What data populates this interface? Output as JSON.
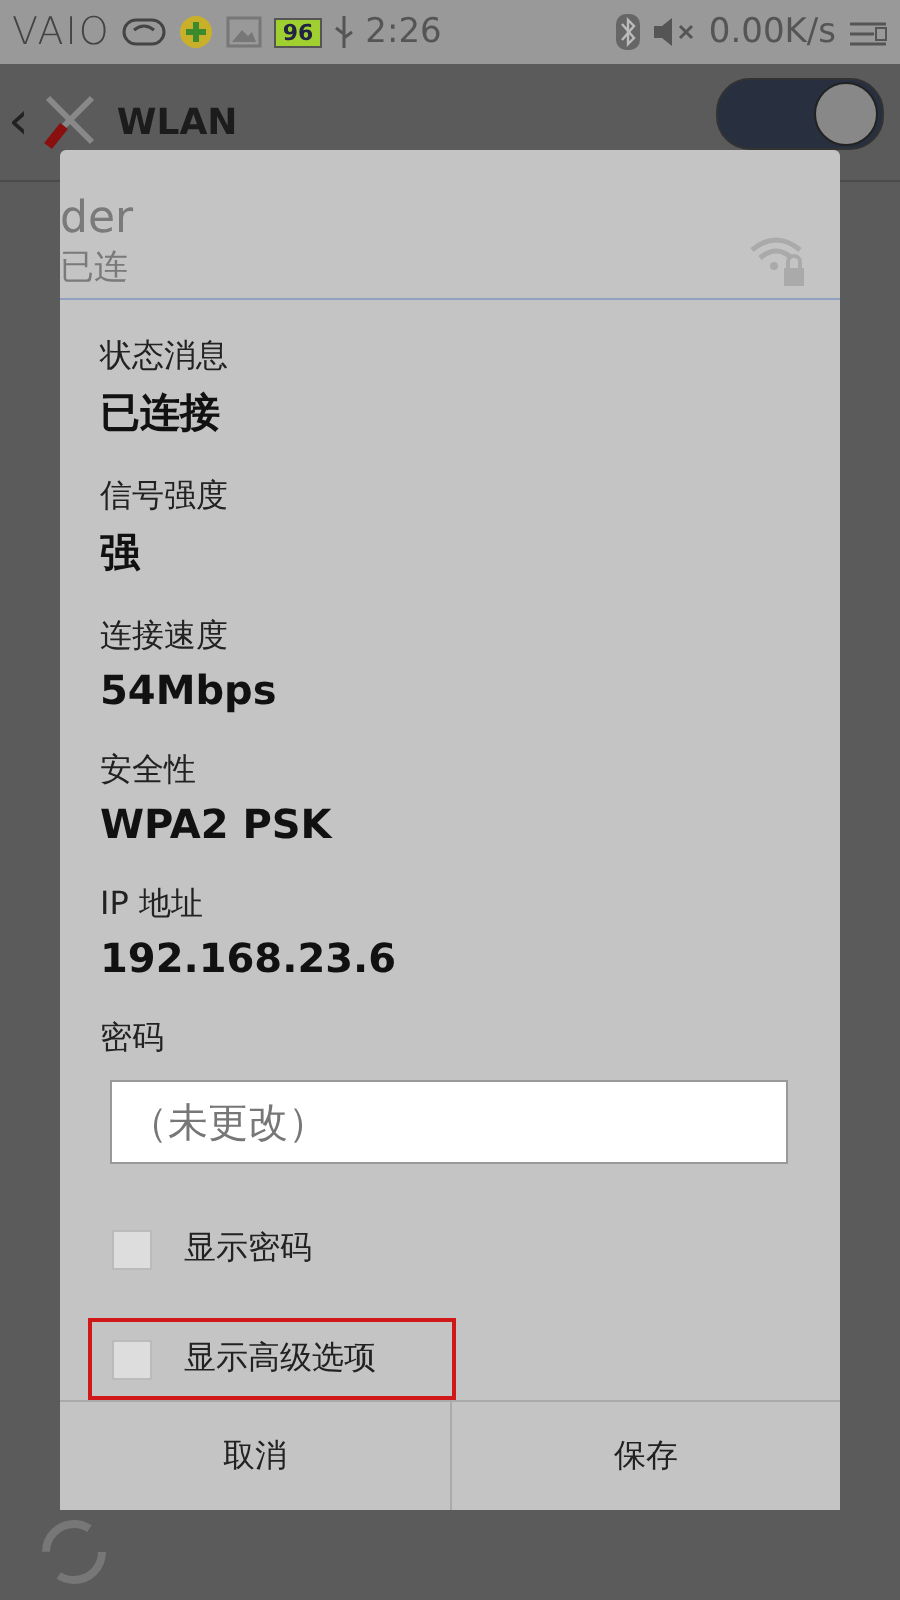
{
  "status_bar": {
    "logo": "VAIO",
    "battery": "96",
    "time": "2:26",
    "speed": "0.00K/s"
  },
  "action_bar": {
    "back": "‹",
    "title": "WLAN",
    "switch_on": true
  },
  "dialog": {
    "network_name": "der",
    "network_status": "已连",
    "details": [
      {
        "label": "状态消息",
        "value": "已连接"
      },
      {
        "label": "信号强度",
        "value": "强"
      },
      {
        "label": "连接速度",
        "value": "54Mbps"
      },
      {
        "label": "安全性",
        "value": "WPA2 PSK"
      },
      {
        "label": "IP 地址",
        "value": "192.168.23.6"
      }
    ],
    "password": {
      "label": "密码",
      "placeholder": "（未更改）"
    },
    "options": [
      {
        "label": "显示密码",
        "checked": false,
        "highlighted": false
      },
      {
        "label": "显示高级选项",
        "checked": false,
        "highlighted": true
      }
    ],
    "buttons": [
      "取消",
      "保存"
    ]
  }
}
